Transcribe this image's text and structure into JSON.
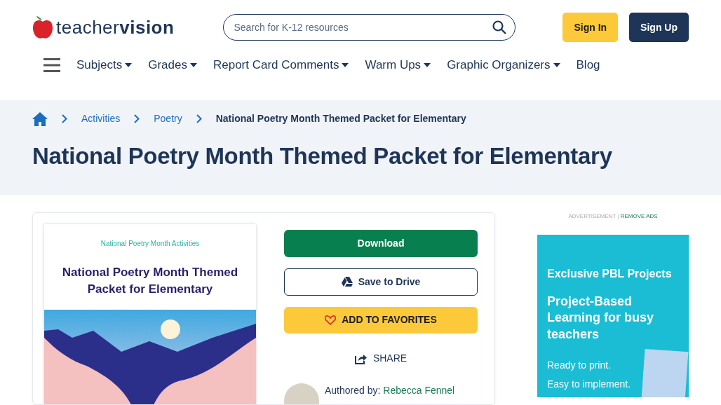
{
  "header": {
    "logo": {
      "light": "teacher",
      "bold": "vision"
    },
    "search": {
      "placeholder": "Search for K-12 resources"
    },
    "buttons": [
      {
        "label": "Sign In",
        "kind": "signin"
      },
      {
        "label": "Sign Up",
        "kind": "signup"
      }
    ]
  },
  "nav": [
    {
      "label": "Subjects",
      "dropdown": true
    },
    {
      "label": "Grades",
      "dropdown": true
    },
    {
      "label": "Report Card Comments",
      "dropdown": true
    },
    {
      "label": "Warm Ups",
      "dropdown": true
    },
    {
      "label": "Graphic Organizers",
      "dropdown": true
    },
    {
      "label": "Blog",
      "dropdown": false
    }
  ],
  "breadcrumb": [
    {
      "label": "Activities",
      "link": true
    },
    {
      "label": "Poetry",
      "link": true
    },
    {
      "label": "National Poetry Month Themed Packet for Elementary",
      "link": false
    }
  ],
  "title": "National Poetry Month Themed Packet for Elementary",
  "cover": {
    "subtitle": "National Poetry Month Activities",
    "title": "National Poetry Month Themed Packet for Elementary"
  },
  "actions": [
    {
      "label": "Download",
      "kind": "download"
    },
    {
      "label": "Save to Drive",
      "kind": "drive"
    },
    {
      "label": "ADD TO FAVORITES",
      "kind": "favorite"
    },
    {
      "label": "SHARE",
      "kind": "share"
    }
  ],
  "author": {
    "prefix": "Authored by:",
    "name": "Rebecca Fennel"
  },
  "ad": {
    "label": "ADVERTISEMENT",
    "separator": "|",
    "remove": "REMOVE ADS",
    "kicker": "Exclusive PBL Projects",
    "headline": "Project-Based Learning for busy teachers",
    "lines": [
      "Ready to print.",
      "Easy to implement."
    ]
  }
}
